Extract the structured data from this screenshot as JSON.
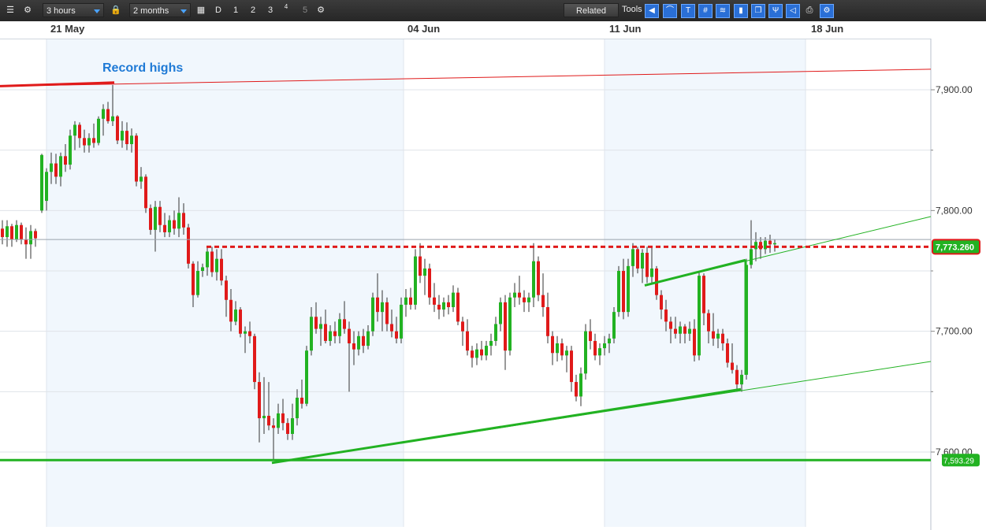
{
  "toolbar": {
    "interval": "3 hours",
    "range": "2 months",
    "periods": [
      "D",
      "1",
      "2",
      "3",
      "4",
      "5"
    ],
    "related_label": "Related",
    "tools_label": "Tools",
    "colors": {
      "background": "#2b2b2b",
      "accent": "#2a6fd6"
    }
  },
  "chart_data": {
    "type": "candlestick",
    "x_tick_labels": [
      "21 May",
      "04 Jun",
      "11 Jun",
      "18 Jun"
    ],
    "y_tick_labels": [
      "7,900.00",
      "7,800.00",
      "7,700.00",
      "7,600.00"
    ],
    "y_ticks": [
      7900,
      7800,
      7700,
      7600
    ],
    "ylim": [
      7540,
      7942
    ],
    "grid": true,
    "colors": {
      "up": "#22b222",
      "down": "#e01a1a",
      "current": "#e01a1a",
      "support": "#22b222"
    },
    "current_price": 7773.26,
    "current_price_label": "7,773.260",
    "support_level": 7593.29,
    "support_label": "7,593.29",
    "annotations": [
      {
        "text": "Record highs",
        "color": "#1f7ad6"
      }
    ],
    "resistance_level": 7770.0,
    "trendlines": [
      {
        "name": "record-high-line",
        "color": "#e01a1a",
        "from": [
          0,
          7903
        ],
        "to": [
          1181,
          7917
        ]
      },
      {
        "name": "lower-support-trend",
        "color": "#22b222",
        "from": [
          345,
          7591
        ],
        "to": [
          1181,
          7675
        ]
      },
      {
        "name": "upper-trend",
        "color": "#22b222",
        "from": [
          818,
          7738
        ],
        "to": [
          1181,
          7795
        ]
      }
    ],
    "candles": [
      {
        "x": 3,
        "o": 7785,
        "h": 7792,
        "l": 7772,
        "c": 7778
      },
      {
        "x": 9,
        "o": 7778,
        "h": 7792,
        "l": 7770,
        "c": 7787
      },
      {
        "x": 15,
        "o": 7787,
        "h": 7789,
        "l": 7770,
        "c": 7776
      },
      {
        "x": 21,
        "o": 7776,
        "h": 7792,
        "l": 7774,
        "c": 7788
      },
      {
        "x": 27,
        "o": 7788,
        "h": 7790,
        "l": 7772,
        "c": 7776
      },
      {
        "x": 33,
        "o": 7776,
        "h": 7786,
        "l": 7760,
        "c": 7772
      },
      {
        "x": 39,
        "o": 7772,
        "h": 7788,
        "l": 7760,
        "c": 7783
      },
      {
        "x": 45,
        "o": 7783,
        "h": 7785,
        "l": 7770,
        "c": 7777
      },
      {
        "x": 53,
        "o": 7800,
        "h": 7847,
        "l": 7798,
        "c": 7846
      },
      {
        "x": 59,
        "o": 7808,
        "h": 7835,
        "l": 7800,
        "c": 7832
      },
      {
        "x": 65,
        "o": 7832,
        "h": 7848,
        "l": 7822,
        "c": 7839
      },
      {
        "x": 71,
        "o": 7839,
        "h": 7847,
        "l": 7822,
        "c": 7828
      },
      {
        "x": 77,
        "o": 7828,
        "h": 7848,
        "l": 7820,
        "c": 7845
      },
      {
        "x": 83,
        "o": 7845,
        "h": 7855,
        "l": 7832,
        "c": 7838
      },
      {
        "x": 89,
        "o": 7838,
        "h": 7867,
        "l": 7834,
        "c": 7862
      },
      {
        "x": 95,
        "o": 7862,
        "h": 7874,
        "l": 7850,
        "c": 7871
      },
      {
        "x": 101,
        "o": 7871,
        "h": 7873,
        "l": 7852,
        "c": 7860
      },
      {
        "x": 107,
        "o": 7860,
        "h": 7867,
        "l": 7848,
        "c": 7854
      },
      {
        "x": 113,
        "o": 7854,
        "h": 7864,
        "l": 7848,
        "c": 7860
      },
      {
        "x": 119,
        "o": 7860,
        "h": 7872,
        "l": 7852,
        "c": 7856
      },
      {
        "x": 125,
        "o": 7856,
        "h": 7878,
        "l": 7854,
        "c": 7876
      },
      {
        "x": 131,
        "o": 7876,
        "h": 7888,
        "l": 7862,
        "c": 7884
      },
      {
        "x": 137,
        "o": 7884,
        "h": 7890,
        "l": 7872,
        "c": 7874
      },
      {
        "x": 143,
        "o": 7874,
        "h": 7904,
        "l": 7870,
        "c": 7878
      },
      {
        "x": 149,
        "o": 7878,
        "h": 7879,
        "l": 7855,
        "c": 7858
      },
      {
        "x": 155,
        "o": 7858,
        "h": 7874,
        "l": 7852,
        "c": 7866
      },
      {
        "x": 161,
        "o": 7866,
        "h": 7873,
        "l": 7850,
        "c": 7855
      },
      {
        "x": 167,
        "o": 7855,
        "h": 7868,
        "l": 7848,
        "c": 7862
      },
      {
        "x": 173,
        "o": 7862,
        "h": 7864,
        "l": 7820,
        "c": 7824
      },
      {
        "x": 179,
        "o": 7824,
        "h": 7836,
        "l": 7818,
        "c": 7828
      },
      {
        "x": 185,
        "o": 7828,
        "h": 7830,
        "l": 7798,
        "c": 7802
      },
      {
        "x": 191,
        "o": 7802,
        "h": 7805,
        "l": 7780,
        "c": 7784
      },
      {
        "x": 197,
        "o": 7784,
        "h": 7808,
        "l": 7766,
        "c": 7803
      },
      {
        "x": 203,
        "o": 7803,
        "h": 7808,
        "l": 7782,
        "c": 7788
      },
      {
        "x": 209,
        "o": 7788,
        "h": 7798,
        "l": 7778,
        "c": 7782
      },
      {
        "x": 215,
        "o": 7782,
        "h": 7796,
        "l": 7778,
        "c": 7792
      },
      {
        "x": 221,
        "o": 7792,
        "h": 7800,
        "l": 7780,
        "c": 7785
      },
      {
        "x": 227,
        "o": 7785,
        "h": 7811,
        "l": 7778,
        "c": 7798
      },
      {
        "x": 233,
        "o": 7798,
        "h": 7806,
        "l": 7780,
        "c": 7786
      },
      {
        "x": 239,
        "o": 7786,
        "h": 7789,
        "l": 7752,
        "c": 7756
      },
      {
        "x": 245,
        "o": 7756,
        "h": 7758,
        "l": 7720,
        "c": 7730
      },
      {
        "x": 251,
        "o": 7730,
        "h": 7758,
        "l": 7728,
        "c": 7750
      },
      {
        "x": 257,
        "o": 7750,
        "h": 7756,
        "l": 7745,
        "c": 7753
      },
      {
        "x": 263,
        "o": 7753,
        "h": 7770,
        "l": 7746,
        "c": 7766
      },
      {
        "x": 269,
        "o": 7766,
        "h": 7770,
        "l": 7745,
        "c": 7749
      },
      {
        "x": 275,
        "o": 7749,
        "h": 7768,
        "l": 7742,
        "c": 7760
      },
      {
        "x": 281,
        "o": 7760,
        "h": 7768,
        "l": 7738,
        "c": 7742
      },
      {
        "x": 287,
        "o": 7742,
        "h": 7746,
        "l": 7712,
        "c": 7726
      },
      {
        "x": 293,
        "o": 7726,
        "h": 7735,
        "l": 7700,
        "c": 7708
      },
      {
        "x": 299,
        "o": 7708,
        "h": 7725,
        "l": 7705,
        "c": 7718
      },
      {
        "x": 305,
        "o": 7718,
        "h": 7720,
        "l": 7695,
        "c": 7698
      },
      {
        "x": 311,
        "o": 7698,
        "h": 7704,
        "l": 7682,
        "c": 7700
      },
      {
        "x": 317,
        "o": 7700,
        "h": 7708,
        "l": 7690,
        "c": 7696
      },
      {
        "x": 323,
        "o": 7696,
        "h": 7698,
        "l": 7652,
        "c": 7658
      },
      {
        "x": 329,
        "o": 7658,
        "h": 7666,
        "l": 7608,
        "c": 7628
      },
      {
        "x": 335,
        "o": 7628,
        "h": 7662,
        "l": 7615,
        "c": 7630
      },
      {
        "x": 341,
        "o": 7630,
        "h": 7658,
        "l": 7618,
        "c": 7622
      },
      {
        "x": 347,
        "o": 7622,
        "h": 7628,
        "l": 7593,
        "c": 7620
      },
      {
        "x": 353,
        "o": 7620,
        "h": 7640,
        "l": 7615,
        "c": 7632
      },
      {
        "x": 359,
        "o": 7632,
        "h": 7644,
        "l": 7618,
        "c": 7624
      },
      {
        "x": 365,
        "o": 7624,
        "h": 7628,
        "l": 7610,
        "c": 7615
      },
      {
        "x": 371,
        "o": 7615,
        "h": 7640,
        "l": 7610,
        "c": 7628
      },
      {
        "x": 377,
        "o": 7628,
        "h": 7652,
        "l": 7622,
        "c": 7645
      },
      {
        "x": 383,
        "o": 7645,
        "h": 7660,
        "l": 7636,
        "c": 7640
      },
      {
        "x": 389,
        "o": 7640,
        "h": 7688,
        "l": 7638,
        "c": 7684
      },
      {
        "x": 395,
        "o": 7684,
        "h": 7720,
        "l": 7680,
        "c": 7712
      },
      {
        "x": 401,
        "o": 7712,
        "h": 7724,
        "l": 7698,
        "c": 7702
      },
      {
        "x": 407,
        "o": 7702,
        "h": 7712,
        "l": 7688,
        "c": 7706
      },
      {
        "x": 413,
        "o": 7706,
        "h": 7718,
        "l": 7690,
        "c": 7692
      },
      {
        "x": 419,
        "o": 7692,
        "h": 7705,
        "l": 7688,
        "c": 7700
      },
      {
        "x": 425,
        "o": 7700,
        "h": 7708,
        "l": 7690,
        "c": 7696
      },
      {
        "x": 431,
        "o": 7696,
        "h": 7715,
        "l": 7690,
        "c": 7710
      },
      {
        "x": 437,
        "o": 7710,
        "h": 7725,
        "l": 7698,
        "c": 7702
      },
      {
        "x": 443,
        "o": 7702,
        "h": 7708,
        "l": 7650,
        "c": 7690
      },
      {
        "x": 449,
        "o": 7690,
        "h": 7700,
        "l": 7672,
        "c": 7685
      },
      {
        "x": 455,
        "o": 7685,
        "h": 7700,
        "l": 7680,
        "c": 7696
      },
      {
        "x": 461,
        "o": 7696,
        "h": 7702,
        "l": 7682,
        "c": 7688
      },
      {
        "x": 467,
        "o": 7688,
        "h": 7705,
        "l": 7685,
        "c": 7700
      },
      {
        "x": 473,
        "o": 7700,
        "h": 7732,
        "l": 7696,
        "c": 7728
      },
      {
        "x": 479,
        "o": 7728,
        "h": 7748,
        "l": 7708,
        "c": 7716
      },
      {
        "x": 485,
        "o": 7716,
        "h": 7734,
        "l": 7700,
        "c": 7724
      },
      {
        "x": 491,
        "o": 7724,
        "h": 7728,
        "l": 7700,
        "c": 7706
      },
      {
        "x": 497,
        "o": 7706,
        "h": 7718,
        "l": 7695,
        "c": 7700
      },
      {
        "x": 503,
        "o": 7700,
        "h": 7712,
        "l": 7690,
        "c": 7694
      },
      {
        "x": 509,
        "o": 7694,
        "h": 7728,
        "l": 7690,
        "c": 7722
      },
      {
        "x": 515,
        "o": 7722,
        "h": 7735,
        "l": 7712,
        "c": 7728
      },
      {
        "x": 521,
        "o": 7728,
        "h": 7736,
        "l": 7718,
        "c": 7722
      },
      {
        "x": 527,
        "o": 7722,
        "h": 7768,
        "l": 7718,
        "c": 7762
      },
      {
        "x": 533,
        "o": 7762,
        "h": 7773,
        "l": 7740,
        "c": 7746
      },
      {
        "x": 539,
        "o": 7746,
        "h": 7760,
        "l": 7730,
        "c": 7752
      },
      {
        "x": 545,
        "o": 7752,
        "h": 7756,
        "l": 7722,
        "c": 7728
      },
      {
        "x": 551,
        "o": 7728,
        "h": 7740,
        "l": 7716,
        "c": 7722
      },
      {
        "x": 557,
        "o": 7722,
        "h": 7730,
        "l": 7710,
        "c": 7718
      },
      {
        "x": 563,
        "o": 7718,
        "h": 7728,
        "l": 7712,
        "c": 7724
      },
      {
        "x": 569,
        "o": 7724,
        "h": 7730,
        "l": 7714,
        "c": 7720
      },
      {
        "x": 575,
        "o": 7720,
        "h": 7738,
        "l": 7716,
        "c": 7732
      },
      {
        "x": 581,
        "o": 7732,
        "h": 7736,
        "l": 7705,
        "c": 7708
      },
      {
        "x": 587,
        "o": 7708,
        "h": 7712,
        "l": 7688,
        "c": 7700
      },
      {
        "x": 593,
        "o": 7700,
        "h": 7710,
        "l": 7680,
        "c": 7684
      },
      {
        "x": 599,
        "o": 7684,
        "h": 7688,
        "l": 7670,
        "c": 7678
      },
      {
        "x": 605,
        "o": 7678,
        "h": 7690,
        "l": 7672,
        "c": 7685
      },
      {
        "x": 611,
        "o": 7685,
        "h": 7692,
        "l": 7676,
        "c": 7680
      },
      {
        "x": 617,
        "o": 7680,
        "h": 7692,
        "l": 7676,
        "c": 7688
      },
      {
        "x": 623,
        "o": 7688,
        "h": 7698,
        "l": 7680,
        "c": 7692
      },
      {
        "x": 629,
        "o": 7692,
        "h": 7712,
        "l": 7688,
        "c": 7706
      },
      {
        "x": 635,
        "o": 7706,
        "h": 7728,
        "l": 7700,
        "c": 7724
      },
      {
        "x": 641,
        "o": 7724,
        "h": 7730,
        "l": 7668,
        "c": 7684
      },
      {
        "x": 647,
        "o": 7684,
        "h": 7732,
        "l": 7680,
        "c": 7728
      },
      {
        "x": 653,
        "o": 7728,
        "h": 7740,
        "l": 7720,
        "c": 7732
      },
      {
        "x": 659,
        "o": 7732,
        "h": 7746,
        "l": 7722,
        "c": 7728
      },
      {
        "x": 665,
        "o": 7728,
        "h": 7734,
        "l": 7716,
        "c": 7724
      },
      {
        "x": 671,
        "o": 7724,
        "h": 7732,
        "l": 7716,
        "c": 7728
      },
      {
        "x": 677,
        "o": 7728,
        "h": 7773,
        "l": 7720,
        "c": 7758
      },
      {
        "x": 683,
        "o": 7758,
        "h": 7762,
        "l": 7725,
        "c": 7730
      },
      {
        "x": 689,
        "o": 7730,
        "h": 7748,
        "l": 7712,
        "c": 7720
      },
      {
        "x": 695,
        "o": 7720,
        "h": 7732,
        "l": 7690,
        "c": 7696
      },
      {
        "x": 701,
        "o": 7696,
        "h": 7700,
        "l": 7672,
        "c": 7682
      },
      {
        "x": 707,
        "o": 7682,
        "h": 7696,
        "l": 7675,
        "c": 7690
      },
      {
        "x": 713,
        "o": 7690,
        "h": 7694,
        "l": 7676,
        "c": 7680
      },
      {
        "x": 719,
        "o": 7680,
        "h": 7688,
        "l": 7666,
        "c": 7684
      },
      {
        "x": 725,
        "o": 7684,
        "h": 7688,
        "l": 7650,
        "c": 7658
      },
      {
        "x": 731,
        "o": 7658,
        "h": 7664,
        "l": 7642,
        "c": 7646
      },
      {
        "x": 737,
        "o": 7646,
        "h": 7670,
        "l": 7638,
        "c": 7665
      },
      {
        "x": 743,
        "o": 7665,
        "h": 7706,
        "l": 7660,
        "c": 7700
      },
      {
        "x": 749,
        "o": 7700,
        "h": 7710,
        "l": 7685,
        "c": 7692
      },
      {
        "x": 755,
        "o": 7692,
        "h": 7698,
        "l": 7676,
        "c": 7680
      },
      {
        "x": 761,
        "o": 7680,
        "h": 7690,
        "l": 7672,
        "c": 7686
      },
      {
        "x": 767,
        "o": 7686,
        "h": 7696,
        "l": 7680,
        "c": 7690
      },
      {
        "x": 773,
        "o": 7690,
        "h": 7698,
        "l": 7682,
        "c": 7694
      },
      {
        "x": 779,
        "o": 7694,
        "h": 7720,
        "l": 7690,
        "c": 7716
      },
      {
        "x": 785,
        "o": 7716,
        "h": 7754,
        "l": 7712,
        "c": 7750
      },
      {
        "x": 791,
        "o": 7750,
        "h": 7760,
        "l": 7710,
        "c": 7716
      },
      {
        "x": 797,
        "o": 7716,
        "h": 7760,
        "l": 7712,
        "c": 7754
      },
      {
        "x": 803,
        "o": 7754,
        "h": 7773,
        "l": 7745,
        "c": 7768
      },
      {
        "x": 809,
        "o": 7768,
        "h": 7770,
        "l": 7748,
        "c": 7752
      },
      {
        "x": 815,
        "o": 7752,
        "h": 7768,
        "l": 7740,
        "c": 7765
      },
      {
        "x": 821,
        "o": 7765,
        "h": 7770,
        "l": 7740,
        "c": 7745
      },
      {
        "x": 827,
        "o": 7745,
        "h": 7770,
        "l": 7740,
        "c": 7752
      },
      {
        "x": 833,
        "o": 7752,
        "h": 7754,
        "l": 7726,
        "c": 7730
      },
      {
        "x": 839,
        "o": 7730,
        "h": 7734,
        "l": 7710,
        "c": 7718
      },
      {
        "x": 845,
        "o": 7718,
        "h": 7726,
        "l": 7700,
        "c": 7708
      },
      {
        "x": 851,
        "o": 7708,
        "h": 7712,
        "l": 7690,
        "c": 7702
      },
      {
        "x": 857,
        "o": 7702,
        "h": 7712,
        "l": 7694,
        "c": 7698
      },
      {
        "x": 863,
        "o": 7698,
        "h": 7708,
        "l": 7690,
        "c": 7704
      },
      {
        "x": 869,
        "o": 7704,
        "h": 7706,
        "l": 7690,
        "c": 7698
      },
      {
        "x": 875,
        "o": 7698,
        "h": 7708,
        "l": 7692,
        "c": 7702
      },
      {
        "x": 881,
        "o": 7702,
        "h": 7710,
        "l": 7675,
        "c": 7680
      },
      {
        "x": 887,
        "o": 7680,
        "h": 7750,
        "l": 7676,
        "c": 7746
      },
      {
        "x": 893,
        "o": 7746,
        "h": 7748,
        "l": 7705,
        "c": 7715
      },
      {
        "x": 899,
        "o": 7715,
        "h": 7718,
        "l": 7690,
        "c": 7700
      },
      {
        "x": 905,
        "o": 7700,
        "h": 7715,
        "l": 7688,
        "c": 7694
      },
      {
        "x": 911,
        "o": 7694,
        "h": 7702,
        "l": 7686,
        "c": 7698
      },
      {
        "x": 917,
        "o": 7698,
        "h": 7702,
        "l": 7684,
        "c": 7690
      },
      {
        "x": 923,
        "o": 7690,
        "h": 7694,
        "l": 7670,
        "c": 7674
      },
      {
        "x": 929,
        "o": 7674,
        "h": 7690,
        "l": 7665,
        "c": 7668
      },
      {
        "x": 935,
        "o": 7668,
        "h": 7672,
        "l": 7650,
        "c": 7656
      },
      {
        "x": 941,
        "o": 7656,
        "h": 7668,
        "l": 7650,
        "c": 7664
      },
      {
        "x": 947,
        "o": 7664,
        "h": 7760,
        "l": 7660,
        "c": 7755
      },
      {
        "x": 953,
        "o": 7755,
        "h": 7792,
        "l": 7752,
        "c": 7768
      },
      {
        "x": 959,
        "o": 7768,
        "h": 7782,
        "l": 7758,
        "c": 7774
      },
      {
        "x": 965,
        "o": 7774,
        "h": 7778,
        "l": 7760,
        "c": 7768
      },
      {
        "x": 971,
        "o": 7768,
        "h": 7778,
        "l": 7764,
        "c": 7775
      },
      {
        "x": 977,
        "o": 7775,
        "h": 7780,
        "l": 7765,
        "c": 7772
      },
      {
        "x": 983,
        "o": 7772,
        "h": 7776,
        "l": 7766,
        "c": 7773
      }
    ]
  }
}
